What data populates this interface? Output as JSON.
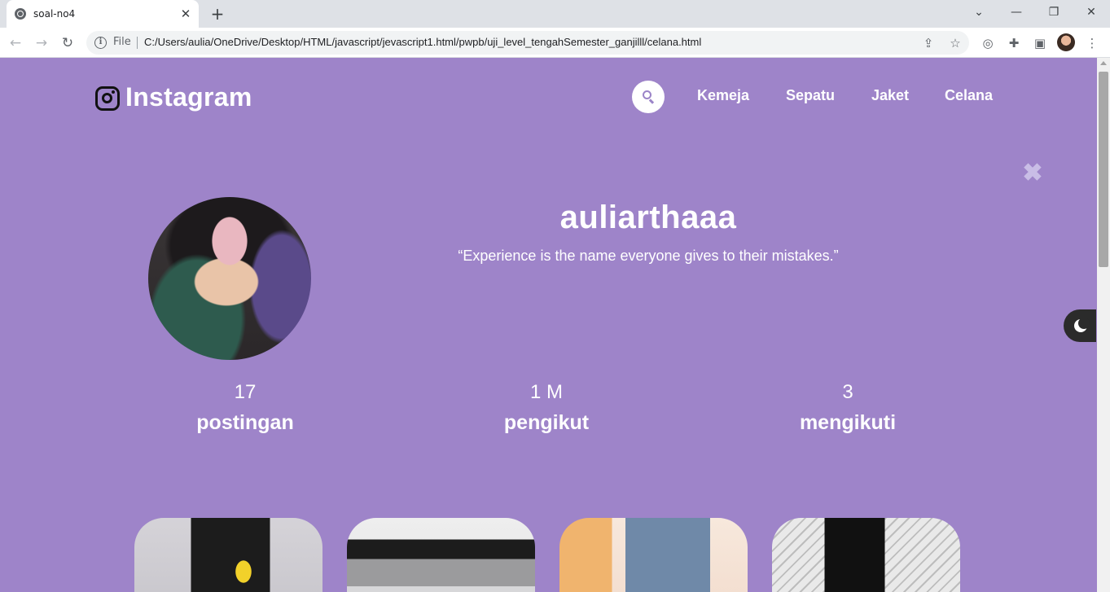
{
  "browser": {
    "tab_title": "soal-no4",
    "file_label": "File",
    "url": "C:/Users/aulia/OneDrive/Desktop/HTML/javascript/jevascript1.html/pwpb/uji_level_tengahSemester_ganjilll/celana.html"
  },
  "page": {
    "background_color": "#9e84c9",
    "accent_color": "#ffffff",
    "logo": {
      "icon": "instagram-icon",
      "text": "Instagram"
    },
    "nav": {
      "search_icon": "search-icon",
      "links": [
        "Kemeja",
        "Sepatu",
        "Jaket",
        "Celana"
      ]
    },
    "close_icon": "close-icon",
    "profile": {
      "username": "auliarthaaa",
      "bio": "“Experience is the name everyone gives to their mistakes.”"
    },
    "stats": [
      {
        "value": "17",
        "label": "postingan"
      },
      {
        "value": "1 M",
        "label": "pengikut"
      },
      {
        "value": "3",
        "label": "mengikuti"
      }
    ],
    "dark_mode_icon": "moon-icon",
    "gallery": [
      "pants-photo-1",
      "pants-photo-2",
      "pants-photo-3",
      "pants-photo-4"
    ]
  }
}
